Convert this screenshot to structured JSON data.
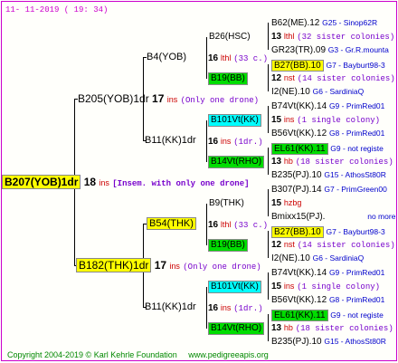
{
  "header": "11-  11-2019  ( 19: 34)",
  "footer": {
    "copyright": "Copyright 2004-2019 © Karl Kehrle Foundation",
    "site": "www.pedigreeapis.org"
  },
  "root": {
    "name": "B207(YOB)1dr",
    "ins_num": "18",
    "ins_text": "ins",
    "note": "[Insem. with only one drone]"
  },
  "gen1": [
    {
      "name": "B205(YOB)1dr",
      "ins_num": "17",
      "ins_text": "ins",
      "note": "(Only one drone)"
    },
    {
      "name": "B182(THK)1dr",
      "ins_num": "17",
      "ins_text": "ins",
      "note": "(Only one drone)"
    }
  ],
  "gen2": [
    {
      "name": "B4(YOB)",
      "ins_num": "16",
      "ins_text": "lthl",
      "note": "(33 c.)"
    },
    {
      "name": "B11(KK)1dr",
      "ins_num": "16",
      "ins_text": "ins",
      "note": "(1dr.)"
    },
    {
      "name": "B54(THK)",
      "ins_num": "16",
      "ins_text": "lthl",
      "note": "(33 c.)"
    },
    {
      "name": "B11(KK)1dr",
      "ins_num": "16",
      "ins_text": "ins",
      "note": "(1dr.)"
    }
  ],
  "gen3": [
    "B26(HSC)",
    "B19(BB)",
    "B101Vt(KK)",
    "B14Vt(RHO)",
    "B9(THK)",
    "B19(BB)",
    "B101Vt(KK)",
    "B14Vt(RHO)"
  ],
  "gen4": [
    {
      "name": "B62(ME).12",
      "ref": "G25 - Sinop62R"
    },
    {
      "num": "13",
      "text": "lthl",
      "note": "(32 sister colonies)"
    },
    {
      "name": "GR23(TR).09",
      "ref": "G3 - Gr.R.mounta"
    },
    {
      "name": "B27(BB).10",
      "ref": "G7 - Bayburt98-3"
    },
    {
      "num": "12",
      "text": "nst",
      "note": "(14 sister colonies)"
    },
    {
      "name": "I2(NE).10",
      "ref": "G6 - SardiniaQ"
    },
    {
      "name": "B74Vt(KK).14",
      "ref": "G9 - PrimRed01"
    },
    {
      "num": "15",
      "text": "ins",
      "note": "(1 single colony)"
    },
    {
      "name": "B56Vt(KK).12",
      "ref": "G8 - PrimRed01"
    },
    {
      "name": "EL61(KK).11",
      "ref": "G9 - not registe"
    },
    {
      "num": "13",
      "text": "hb",
      "note": "(18 sister colonies)"
    },
    {
      "name": "B235(PJ).10",
      "ref": "G15 - AthosSt80R"
    },
    {
      "name": "B307(PJ).14",
      "ref": "G7 - PrimGreen00"
    },
    {
      "num": "15",
      "text": "hzbg",
      "note": ""
    },
    {
      "name": "Bmixx15(PJ).",
      "ref": "no more"
    },
    {
      "name": "B27(BB).10",
      "ref": "G7 - Bayburt98-3"
    },
    {
      "num": "12",
      "text": "nst",
      "note": "(14 sister colonies)"
    },
    {
      "name": "I2(NE).10",
      "ref": "G6 - SardiniaQ"
    },
    {
      "name": "B74Vt(KK).14",
      "ref": "G9 - PrimRed01"
    },
    {
      "num": "15",
      "text": "ins",
      "note": "(1 single colony)"
    },
    {
      "name": "B56Vt(KK).12",
      "ref": "G8 - PrimRed01"
    },
    {
      "name": "EL61(KK).11",
      "ref": "G9 - not registe"
    },
    {
      "num": "13",
      "text": "hb",
      "note": "(18 sister colonies)"
    },
    {
      "name": "B235(PJ).10",
      "ref": "G15 - AthosSt80R"
    }
  ],
  "colors": {
    "yellow": "#ffff00",
    "green": "#00dd00",
    "cyan": "#00ffff",
    "frame": "#cc00cc"
  }
}
